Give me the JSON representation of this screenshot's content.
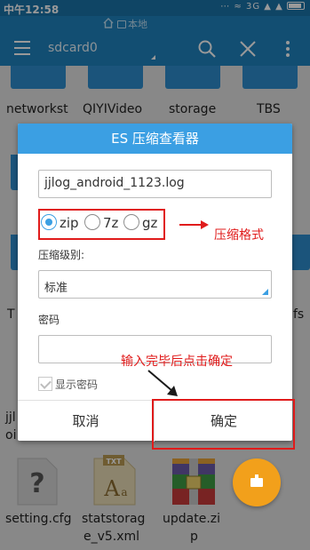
{
  "statusbar": {
    "time": "中午12:58",
    "indicators": "⋯ ≈ 3G ▲ ▲"
  },
  "breadcrumb": {
    "home_icon": "home-icon",
    "location": "本地"
  },
  "toolbar": {
    "path": "sdcard0",
    "menu_icon": "hamburger-icon",
    "search_icon": "search-icon",
    "close_icon": "close-icon",
    "more_icon": "more-vert-icon"
  },
  "files": {
    "row1": [
      "networkst",
      "QIYIVideo",
      "storage",
      "TBS"
    ],
    "left_partial_1": "T",
    "right_partial_1": "fs",
    "left_partial_2": "jjl",
    "left_partial_3": "oi",
    "row_bottom": [
      {
        "name": "setting.cfg",
        "icon": "question-doc-icon"
      },
      {
        "name": "statstorag",
        "name2": "e_v5.xml",
        "icon": "txt-doc-icon",
        "badge": "TXT"
      },
      {
        "name": "update.zi",
        "name2": "p",
        "icon": "zip-archive-icon"
      }
    ]
  },
  "dialog": {
    "title": "ES 压缩查看器",
    "filename": "jjlog_android_1123.log",
    "formats": [
      {
        "label": "zip",
        "selected": true
      },
      {
        "label": "7z",
        "selected": false
      },
      {
        "label": "gz",
        "selected": false
      }
    ],
    "level_label": "压缩级别:",
    "level_value": "标准",
    "password_label": "密码",
    "password_value": "",
    "show_password_label": "显示密码",
    "cancel_label": "取消",
    "ok_label": "确定"
  },
  "annotations": {
    "format_note": "压缩格式",
    "confirm_note": "输入完毕后点击确定",
    "color": "#e01b1b"
  },
  "colors": {
    "accent": "#3b9fe3",
    "toolbar": "#1f82bf",
    "fab": "#f2a01b"
  }
}
